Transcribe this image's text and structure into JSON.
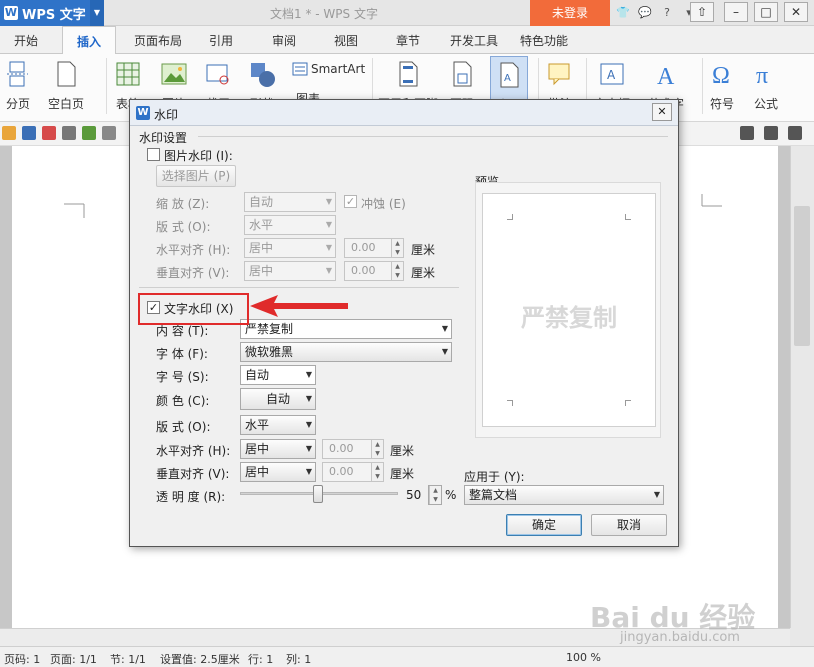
{
  "titlebar": {
    "app_name": "WPS 文字",
    "doc_title": "文档1 * - WPS 文字",
    "login": "未登录"
  },
  "tabs": [
    "开始",
    "插入",
    "页面布局",
    "引用",
    "审阅",
    "视图",
    "章节",
    "开发工具",
    "特色功能"
  ],
  "ribbon": {
    "page_break": "分页",
    "blank_page": "空白页",
    "table": "表格",
    "picture": "图片",
    "screenshot": "截屏",
    "shape": "形状",
    "chart": "图表",
    "smartart": "SmartArt",
    "header_footer": "页眉和页脚",
    "page_number": "页码",
    "watermark": "水印",
    "comment": "批注",
    "textbox": "文本框",
    "wordart": "艺术字",
    "symbol": "符号",
    "formula": "公式"
  },
  "dialog": {
    "title": "水印",
    "section": "水印设置",
    "picture_wm": "图片水印 (I):",
    "select_picture": "选择图片 (P)",
    "scale_label": "缩    放 (Z):",
    "scale_value": "自动",
    "washout": "冲蚀 (E)",
    "layout_label_1": "版    式 (O):",
    "layout_value_1": "水平",
    "halign_label_1": "水平对齐 (H):",
    "halign_value_1": "居中",
    "halign_offset_1": "0.00",
    "unit_1": "厘米",
    "valign_label_1": "垂直对齐 (V):",
    "valign_value_1": "居中",
    "valign_offset_1": "0.00",
    "unit_2": "厘米",
    "text_wm": "文字水印 (X)",
    "content_label": "内    容 (T):",
    "content_value": "严禁复制",
    "font_label": "字    体 (F):",
    "font_value": "微软雅黑",
    "size_label": "字    号 (S):",
    "size_value": "自动",
    "color_label": "颜    色 (C):",
    "color_value": "自动",
    "layout_label_2": "版    式 (O):",
    "layout_value_2": "水平",
    "halign_label_2": "水平对齐 (H):",
    "halign_value_2": "居中",
    "halign_offset_2": "0.00",
    "unit_3": "厘米",
    "valign_label_2": "垂直对齐 (V):",
    "valign_value_2": "居中",
    "valign_offset_2": "0.00",
    "unit_4": "厘米",
    "transparency_label": "透 明 度 (R):",
    "transparency_value": "50",
    "percent": "%",
    "preview_label": "预览",
    "preview_text": "严禁复制",
    "apply_label": "应用于 (Y):",
    "apply_value": "整篇文档",
    "ok": "确定",
    "cancel": "取消"
  },
  "status": {
    "page_code": "页码: 1",
    "pages": "页面: 1/1",
    "section": "节: 1/1",
    "setting": "设置值: 2.5厘米",
    "row": "行: 1",
    "col": "列: 1",
    "zoom": "100 %"
  },
  "watermark_site": {
    "logo": "Bai du 经验",
    "url": "jingyan.baidu.com"
  },
  "colors": {
    "accent": "#2f73c8",
    "login": "#f26b3a",
    "highlight": "#e02b2b"
  }
}
